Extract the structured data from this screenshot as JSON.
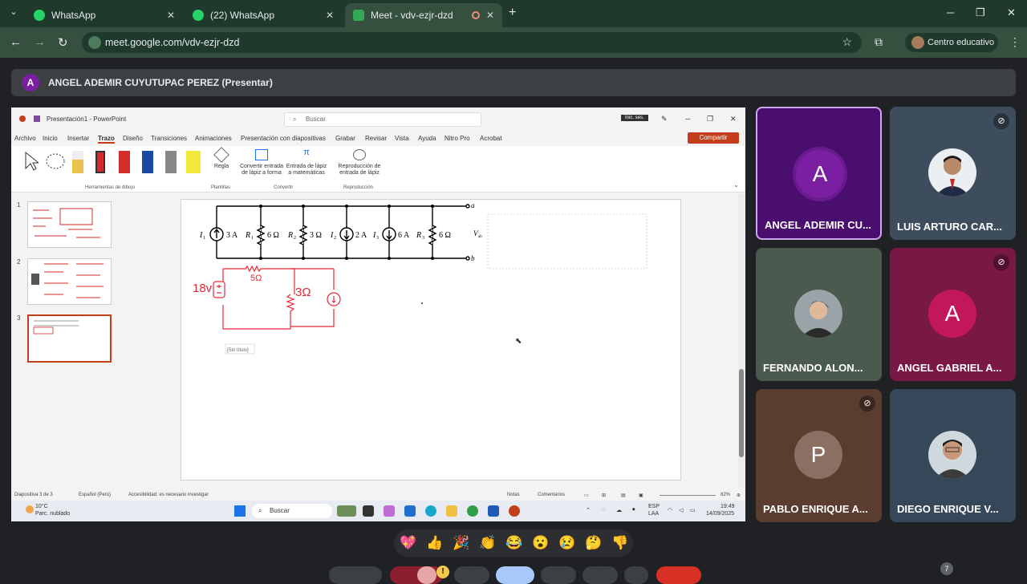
{
  "browser": {
    "tabs": [
      {
        "title": "WhatsApp",
        "active": false
      },
      {
        "title": "(22) WhatsApp",
        "active": false
      },
      {
        "title": "Meet - vdv-ezjr-dzd",
        "active": true
      }
    ],
    "url": "meet.google.com/vdv-ezjr-dzd",
    "profile": "Centro educativo"
  },
  "meet": {
    "presenter_initial": "A",
    "presenter_label": "ANGEL ADEMIR CUYUTUPAC PEREZ (Presentar)",
    "participants": [
      {
        "name": "ANGEL ADEMIR CU...",
        "initial": "A",
        "type": "avatar",
        "color": "#7b1fa2",
        "bg": "#4a0f6e",
        "muted": false,
        "highlighted": true
      },
      {
        "name": "LUIS ARTURO CAR...",
        "initial": "",
        "type": "photo",
        "bg": "#3e4d5e",
        "muted": true,
        "highlighted": false
      },
      {
        "name": "FERNANDO ALON...",
        "initial": "",
        "type": "photo",
        "bg": "#4b5a4f",
        "muted": false,
        "highlighted": false
      },
      {
        "name": "ANGEL GABRIEL A...",
        "initial": "A",
        "type": "avatar",
        "color": "#c2185b",
        "bg": "#7a1845",
        "muted": true,
        "highlighted": false
      },
      {
        "name": "PABLO ENRIQUE A...",
        "initial": "P",
        "type": "avatar",
        "color": "#8d6e63",
        "bg": "#5b3d30",
        "muted": true,
        "highlighted": false
      },
      {
        "name": "DIEGO ENRIQUE V...",
        "initial": "",
        "type": "photo",
        "bg": "#37475a",
        "muted": false,
        "highlighted": false
      }
    ],
    "reactions": [
      "💖",
      "👍",
      "🎉",
      "👏",
      "😂",
      "😮",
      "😢",
      "🤔",
      "👎"
    ],
    "badge_count": "7"
  },
  "ppt": {
    "title": "Presentación1 - PowerPoint",
    "search_placeholder": "Buscar",
    "inic_ses": "Inic. ses.",
    "share": "Compartir",
    "tabs": [
      "Archivo",
      "Inicio",
      "Insertar",
      "Trazo",
      "Diseño",
      "Transiciones",
      "Animaciones",
      "Presentación con diapositivas",
      "Grabar",
      "Revisar",
      "Vista",
      "Ayuda",
      "Nitro Pro",
      "Acrobat"
    ],
    "groups": {
      "drawing_tools": "Herramientas de dibujo",
      "stencils": "Plantillas",
      "convert": "Convertir",
      "replay": "Reproducción"
    },
    "commands": {
      "ruler": "Regla",
      "ink_to_shape_1": "Convertir entrada",
      "ink_to_shape_2": "de lápiz a forma",
      "ink_to_math_1": "Entrada de lápiz",
      "ink_to_math_2": "a matemáticas",
      "ink_replay_1": "Reproducción de",
      "ink_replay_2": "entrada de lápiz"
    },
    "slide_numbers": [
      "1",
      "2",
      "3"
    ],
    "slide_labels": {
      "i1": "I",
      "i1sub": "1",
      "i1val": "3 A",
      "r1": "R",
      "r1sub": "1",
      "r1val": "6 Ω",
      "r2": "R",
      "r2sub": "2",
      "r2val": "3 Ω",
      "i2": "I",
      "i2sub": "2",
      "i2val": "2 A",
      "i3": "I",
      "i3sub": "3",
      "i3val": "6 A",
      "r3": "R",
      "r3sub": "3",
      "r3val": "6 Ω",
      "node_a": "a",
      "node_b": "b",
      "vab": "V",
      "vabsub": "ab",
      "hw_source": "18v",
      "hw_r_top": "5Ω",
      "hw_r_mid": "3Ω",
      "untitled": "[Sin título]"
    },
    "status": {
      "slide": "Diapositiva 3 de 3",
      "lang": "Español (Perú)",
      "access": "Accesibilidad: es necesario investigar",
      "notes": "Notas",
      "comments": "Comentarios",
      "zoom": "82%"
    },
    "taskbar": {
      "temp": "10°C",
      "weather": "Parc. nublado",
      "search": "Buscar",
      "lang1": "ESP",
      "lang2": "LAA",
      "time": "19:49",
      "date": "14/09/2025"
    }
  }
}
